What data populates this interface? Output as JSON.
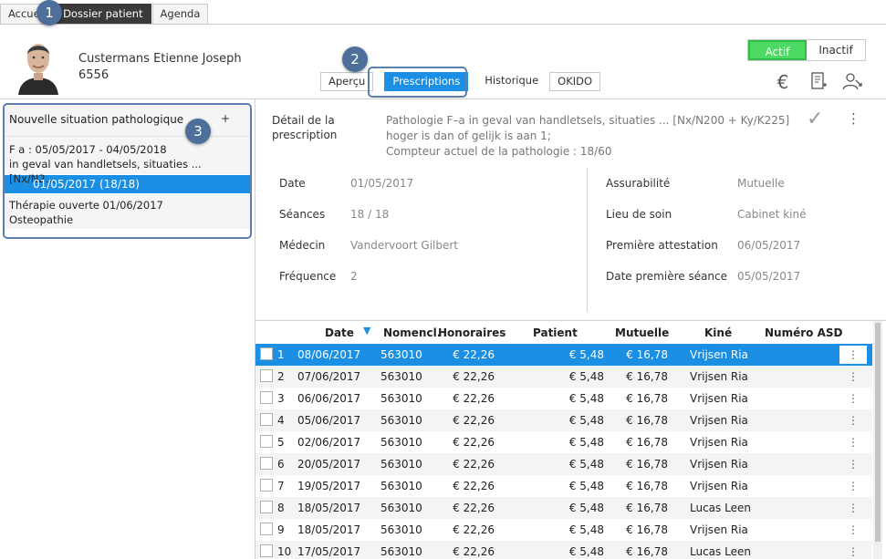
{
  "top_tabs": [
    "Accueil",
    "Dossier patient",
    "Agenda"
  ],
  "patient": {
    "name": "Custermans Etienne Joseph",
    "id": "6556"
  },
  "sub_tabs": [
    "Aperçu",
    "Prescriptions",
    "Historique",
    "OKIDO"
  ],
  "status_toggle": {
    "on": "Actif",
    "off": "Inactif"
  },
  "header_icons": [
    "euro-icon",
    "invoice-icon",
    "user-switch-icon"
  ],
  "callouts": [
    "1",
    "2",
    "3"
  ],
  "left_panel": {
    "header": "Nouvelle situation pathologique",
    "plus": "+",
    "situation1_line1": "F a : 05/05/2017 - 04/05/2018",
    "situation1_line2": "in geval van handletsels, situaties ... [Nx/N2...",
    "selected_prescription": "01/05/2017  (18/18)",
    "situation2_line1": "Thérapie ouverte 01/06/2017",
    "situation2_line2": "Osteopathie"
  },
  "detail": {
    "label_line1": "Détail de la",
    "label_line2": "prescription",
    "text_line1": "Pathologie F–a in geval van handletsels, situaties ... [Nx/N200 + Ky/K225]",
    "text_line2": "hoger is dan of gelijk is aan 1;",
    "text_line3": "Compteur actuel de la pathologie : 18/60"
  },
  "fields_left": [
    {
      "label": "Date",
      "value": "01/05/2017"
    },
    {
      "label": "Séances",
      "value": "18 / 18"
    },
    {
      "label": "Médecin",
      "value": "Vandervoort Gilbert"
    },
    {
      "label": "Fréquence",
      "value": "2"
    }
  ],
  "fields_right": [
    {
      "label": "Assurabilité",
      "value": "Mutuelle"
    },
    {
      "label": "Lieu de soin",
      "value": "Cabinet kiné"
    },
    {
      "label": "Première attestation",
      "value": "06/05/2017"
    },
    {
      "label": "Date première séance",
      "value": "05/05/2017"
    }
  ],
  "grid": {
    "headers": [
      "Date",
      "Nomencl.",
      "Honoraires",
      "Patient",
      "Mutuelle",
      "Kiné",
      "Numéro ASD"
    ],
    "rows": [
      {
        "n": "1",
        "date": "08/06/2017",
        "nomencl": "563010",
        "honoraires": "€ 22,26",
        "patient": "€ 5,48",
        "mutuelle": "€ 16,78",
        "kine": "Vrijsen Ria"
      },
      {
        "n": "2",
        "date": "07/06/2017",
        "nomencl": "563010",
        "honoraires": "€ 22,26",
        "patient": "€ 5,48",
        "mutuelle": "€ 16,78",
        "kine": "Vrijsen Ria"
      },
      {
        "n": "3",
        "date": "06/06/2017",
        "nomencl": "563010",
        "honoraires": "€ 22,26",
        "patient": "€ 5,48",
        "mutuelle": "€ 16,78",
        "kine": "Vrijsen Ria"
      },
      {
        "n": "4",
        "date": "05/06/2017",
        "nomencl": "563010",
        "honoraires": "€ 22,26",
        "patient": "€ 5,48",
        "mutuelle": "€ 16,78",
        "kine": "Vrijsen Ria"
      },
      {
        "n": "5",
        "date": "02/06/2017",
        "nomencl": "563010",
        "honoraires": "€ 22,26",
        "patient": "€ 5,48",
        "mutuelle": "€ 16,78",
        "kine": "Vrijsen Ria"
      },
      {
        "n": "6",
        "date": "20/05/2017",
        "nomencl": "563010",
        "honoraires": "€ 22,26",
        "patient": "€ 5,48",
        "mutuelle": "€ 16,78",
        "kine": "Vrijsen Ria"
      },
      {
        "n": "7",
        "date": "19/05/2017",
        "nomencl": "563010",
        "honoraires": "€ 22,26",
        "patient": "€ 5,48",
        "mutuelle": "€ 16,78",
        "kine": "Vrijsen Ria"
      },
      {
        "n": "8",
        "date": "18/05/2017",
        "nomencl": "563010",
        "honoraires": "€ 22,26",
        "patient": "€ 5,48",
        "mutuelle": "€ 16,78",
        "kine": "Lucas Leen"
      },
      {
        "n": "9",
        "date": "18/05/2017",
        "nomencl": "563010",
        "honoraires": "€ 22,26",
        "patient": "€ 5,48",
        "mutuelle": "€ 16,78",
        "kine": "Vrijsen Ria"
      },
      {
        "n": "10",
        "date": "17/05/2017",
        "nomencl": "563010",
        "honoraires": "€ 22,26",
        "patient": "€ 5,48",
        "mutuelle": "€ 16,78",
        "kine": "Lucas Leen"
      }
    ]
  },
  "colors": {
    "accent": "#1a8fe3",
    "active_green": "#4cd964",
    "callout": "#4d6f9a"
  }
}
